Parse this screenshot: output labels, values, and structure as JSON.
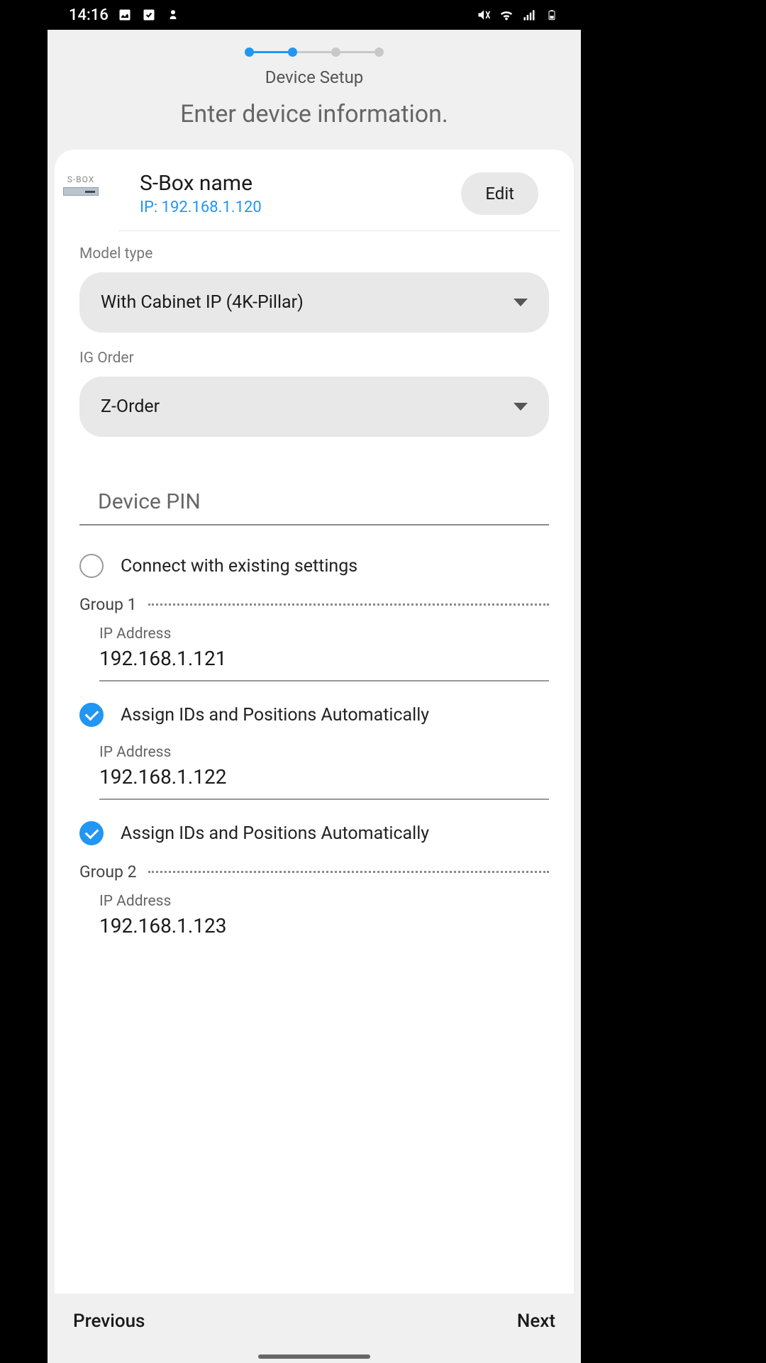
{
  "status": {
    "time": "14:16"
  },
  "stepper": {
    "label": "Device Setup",
    "title": "Enter device information."
  },
  "device": {
    "icon_label": "S-BOX",
    "name": "S-Box name",
    "ip_prefix": "IP: ",
    "ip": "192.168.1.120",
    "edit_label": "Edit"
  },
  "model_type": {
    "label": "Model type",
    "value": "With Cabinet IP (4K-Pillar)"
  },
  "ig_order": {
    "label": "IG Order",
    "value": "Z-Order"
  },
  "pin": {
    "placeholder": "Device PIN"
  },
  "connect_existing": {
    "label": "Connect with existing settings"
  },
  "assign_auto": {
    "label": "Assign IDs and Positions Automatically"
  },
  "groups": {
    "g1_label": "Group 1",
    "g2_label": "Group 2",
    "ip_label": "IP Address",
    "ip1": "192.168.1.121",
    "ip2": "192.168.1.122",
    "ip3": "192.168.1.123"
  },
  "footer": {
    "prev": "Previous",
    "next": "Next"
  }
}
